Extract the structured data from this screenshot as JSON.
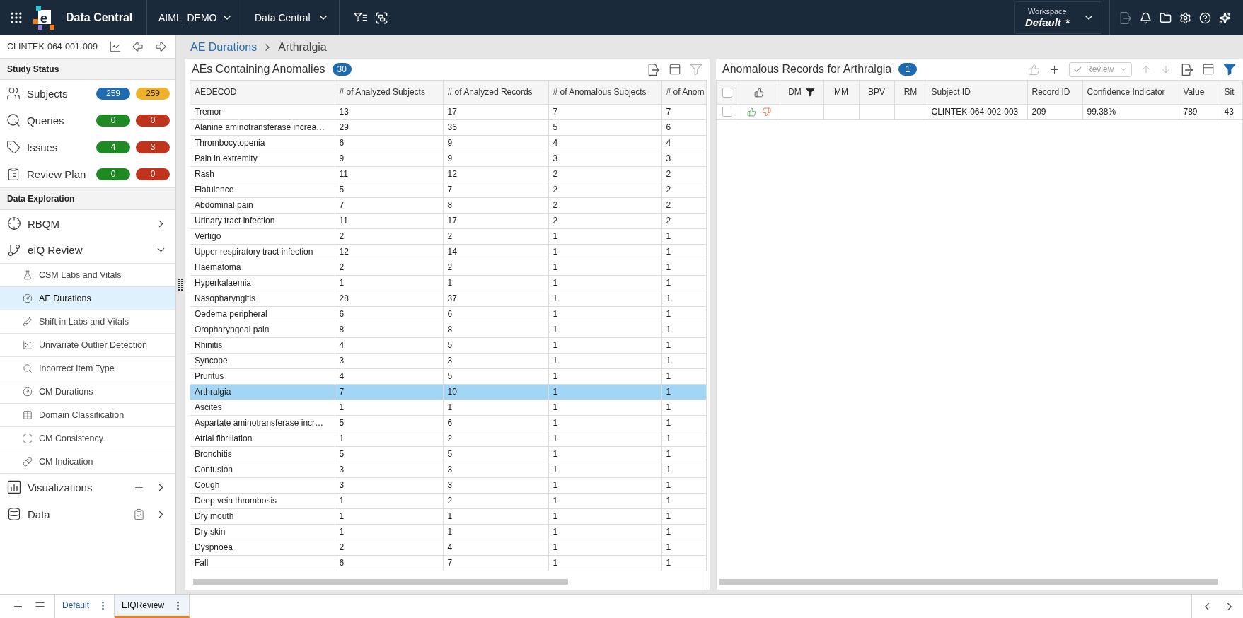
{
  "top_bar": {
    "logo_letter": "e",
    "app_name": "Data Central",
    "menus": [
      {
        "label": "AIML_DEMO"
      },
      {
        "label": "Data Central"
      }
    ],
    "workspace": {
      "caption": "Workspace",
      "value": "Default",
      "unsaved_mark": "*"
    }
  },
  "sidebar": {
    "study_id": "CLINTEK-064-001-009",
    "study_status": {
      "title": "Study Status",
      "items": [
        {
          "label": "Subjects",
          "counts": [
            {
              "value": "259",
              "color": "#1e6bb0"
            },
            {
              "value": "259",
              "color": "#f0b12a"
            }
          ]
        },
        {
          "label": "Queries",
          "counts": [
            {
              "value": "0",
              "color": "#1f8a24"
            },
            {
              "value": "0",
              "color": "#c0341d"
            }
          ]
        },
        {
          "label": "Issues",
          "counts": [
            {
              "value": "4",
              "color": "#1f8a24"
            },
            {
              "value": "3",
              "color": "#c0341d"
            }
          ]
        },
        {
          "label": "Review Plan",
          "counts": [
            {
              "value": "0",
              "color": "#1f8a24"
            },
            {
              "value": "0",
              "color": "#c0341d"
            }
          ]
        }
      ]
    },
    "data_exploration": {
      "title": "Data Exploration",
      "items": [
        {
          "label": "RBQM",
          "expanded": false
        },
        {
          "label": "eIQ Review",
          "expanded": true,
          "children": [
            {
              "label": "CSM Labs and Vitals",
              "selected": false
            },
            {
              "label": "AE Durations",
              "selected": true
            },
            {
              "label": "Shift in Labs and Vitals",
              "selected": false
            },
            {
              "label": "Univariate Outlier Detection",
              "selected": false
            },
            {
              "label": "Incorrect Item Type",
              "selected": false
            },
            {
              "label": "CM Durations",
              "selected": false
            },
            {
              "label": "Domain Classification",
              "selected": false
            },
            {
              "label": "CM Consistency",
              "selected": false
            },
            {
              "label": "CM Indication",
              "selected": false
            }
          ]
        },
        {
          "label": "Visualizations",
          "expanded": false
        },
        {
          "label": "Data",
          "expanded": false
        }
      ]
    }
  },
  "breadcrumb": [
    {
      "label": "AE Durations"
    },
    {
      "label": "Arthralgia"
    }
  ],
  "left_panel": {
    "title": "AEs Containing Anomalies",
    "count": "30",
    "filter_active": false,
    "table": {
      "columns": [
        "AEDECOD",
        "# of Analyzed Subjects",
        "# of Analyzed Records",
        "# of Anomalous Subjects",
        "# of Anom"
      ],
      "rows": [
        {
          "cells": [
            "Tremor",
            "13",
            "17",
            "7",
            "7"
          ],
          "selected": false
        },
        {
          "cells": [
            "Alanine aminotransferase increa…",
            "29",
            "36",
            "5",
            "6"
          ],
          "selected": false
        },
        {
          "cells": [
            "Thrombocytopenia",
            "6",
            "9",
            "4",
            "4"
          ],
          "selected": false
        },
        {
          "cells": [
            "Pain in extremity",
            "9",
            "9",
            "3",
            "3"
          ],
          "selected": false
        },
        {
          "cells": [
            "Rash",
            "11",
            "12",
            "2",
            "2"
          ],
          "selected": false
        },
        {
          "cells": [
            "Flatulence",
            "5",
            "7",
            "2",
            "2"
          ],
          "selected": false
        },
        {
          "cells": [
            "Abdominal pain",
            "7",
            "8",
            "2",
            "2"
          ],
          "selected": false
        },
        {
          "cells": [
            "Urinary tract infection",
            "11",
            "17",
            "2",
            "2"
          ],
          "selected": false
        },
        {
          "cells": [
            "Vertigo",
            "2",
            "2",
            "1",
            "1"
          ],
          "selected": false
        },
        {
          "cells": [
            "Upper respiratory tract infection",
            "12",
            "14",
            "1",
            "1"
          ],
          "selected": false
        },
        {
          "cells": [
            "Haematoma",
            "2",
            "2",
            "1",
            "1"
          ],
          "selected": false
        },
        {
          "cells": [
            "Hyperkalaemia",
            "1",
            "1",
            "1",
            "1"
          ],
          "selected": false
        },
        {
          "cells": [
            "Nasopharyngitis",
            "28",
            "37",
            "1",
            "1"
          ],
          "selected": false
        },
        {
          "cells": [
            "Oedema peripheral",
            "6",
            "6",
            "1",
            "1"
          ],
          "selected": false
        },
        {
          "cells": [
            "Oropharyngeal pain",
            "8",
            "8",
            "1",
            "1"
          ],
          "selected": false
        },
        {
          "cells": [
            "Rhinitis",
            "4",
            "5",
            "1",
            "1"
          ],
          "selected": false
        },
        {
          "cells": [
            "Syncope",
            "3",
            "3",
            "1",
            "1"
          ],
          "selected": false
        },
        {
          "cells": [
            "Pruritus",
            "4",
            "5",
            "1",
            "1"
          ],
          "selected": false
        },
        {
          "cells": [
            "Arthralgia",
            "7",
            "10",
            "1",
            "1"
          ],
          "selected": true
        },
        {
          "cells": [
            "Ascites",
            "1",
            "1",
            "1",
            "1"
          ],
          "selected": false
        },
        {
          "cells": [
            "Aspartate aminotransferase incr…",
            "5",
            "6",
            "1",
            "1"
          ],
          "selected": false
        },
        {
          "cells": [
            "Atrial fibrillation",
            "1",
            "2",
            "1",
            "1"
          ],
          "selected": false
        },
        {
          "cells": [
            "Bronchitis",
            "5",
            "5",
            "1",
            "1"
          ],
          "selected": false
        },
        {
          "cells": [
            "Contusion",
            "3",
            "3",
            "1",
            "1"
          ],
          "selected": false
        },
        {
          "cells": [
            "Cough",
            "3",
            "3",
            "1",
            "1"
          ],
          "selected": false
        },
        {
          "cells": [
            "Deep vein thrombosis",
            "1",
            "2",
            "1",
            "1"
          ],
          "selected": false
        },
        {
          "cells": [
            "Dry mouth",
            "1",
            "1",
            "1",
            "1"
          ],
          "selected": false
        },
        {
          "cells": [
            "Dry skin",
            "1",
            "1",
            "1",
            "1"
          ],
          "selected": false
        },
        {
          "cells": [
            "Dyspnoea",
            "2",
            "4",
            "1",
            "1"
          ],
          "selected": false
        },
        {
          "cells": [
            "Fall",
            "6",
            "7",
            "1",
            "1"
          ],
          "selected": false
        }
      ]
    }
  },
  "right_panel": {
    "title": "Anomalous Records for Arthralgia",
    "count": "1",
    "review_button": {
      "label": "Review"
    },
    "filter_active": true,
    "table": {
      "select_all": {
        "checked": false
      },
      "columns": [
        {
          "kind": "flag",
          "label": "DM",
          "filtered": true
        },
        {
          "kind": "flag",
          "label": "MM",
          "filtered": false
        },
        {
          "kind": "flag",
          "label": "BPV",
          "filtered": false
        },
        {
          "kind": "flag",
          "label": "RM",
          "filtered": false
        },
        {
          "kind": "text",
          "label": "Subject ID"
        },
        {
          "kind": "text",
          "label": "Record ID"
        },
        {
          "kind": "text",
          "label": "Confidence Indicator"
        },
        {
          "kind": "text",
          "label": "Value"
        },
        {
          "kind": "text",
          "label": "Sit"
        }
      ],
      "rows": [
        {
          "checked": false,
          "cells": [
            "",
            "",
            "",
            "",
            "CLINTEK-064-002-003",
            "209",
            "99.38%",
            "789",
            "43"
          ]
        }
      ]
    }
  },
  "bottom_bar": {
    "tabs": [
      {
        "label": "Default",
        "selected": false
      },
      {
        "label": "EIQReview",
        "selected": true
      }
    ]
  }
}
